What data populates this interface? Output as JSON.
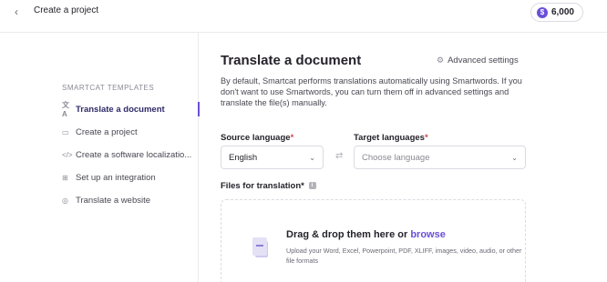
{
  "header": {
    "back_glyph": "‹",
    "title": "Create a project",
    "credits_value": "6,000",
    "credits_icon": "coin-icon",
    "credits_icon_glyph": "$"
  },
  "sidebar": {
    "heading": "SMARTCAT TEMPLATES",
    "items": [
      {
        "label": "Translate a document",
        "icon": "translate-icon",
        "glyph": "文A",
        "active": true
      },
      {
        "label": "Create a project",
        "icon": "folder-icon",
        "glyph": "▭",
        "active": false
      },
      {
        "label": "Create a software localizatio...",
        "icon": "code-icon",
        "glyph": "</>",
        "active": false
      },
      {
        "label": "Set up an integration",
        "icon": "integration-icon",
        "glyph": "⊞",
        "active": false
      },
      {
        "label": "Translate a website",
        "icon": "globe-icon",
        "glyph": "◎",
        "active": false
      }
    ]
  },
  "main": {
    "title": "Translate a document",
    "advanced_settings": "Advanced settings",
    "advanced_glyph": "⚙",
    "description": "By default, Smartcat performs translations automatically using Smartwords. If you don't want to use Smartwords, you can turn them off in advanced settings and translate the file(s) manually.",
    "source_label": "Source language",
    "source_value": "English",
    "target_label": "Target languages",
    "target_placeholder": "Choose language",
    "required_mark": "*",
    "swap_glyph": "⇄",
    "chevron_glyph": "⌄",
    "files_label": "Files for translation",
    "info_glyph": "i",
    "dropzone": {
      "title": "Drag & drop them here or",
      "browse": "browse",
      "subtitle": "Upload your Word, Excel, Powerpoint, PDF, XLIFF, images, video, audio, or other file formats"
    }
  },
  "colors": {
    "accent": "#6b4fd8",
    "required": "#d24b4b",
    "text": "#25222b"
  }
}
